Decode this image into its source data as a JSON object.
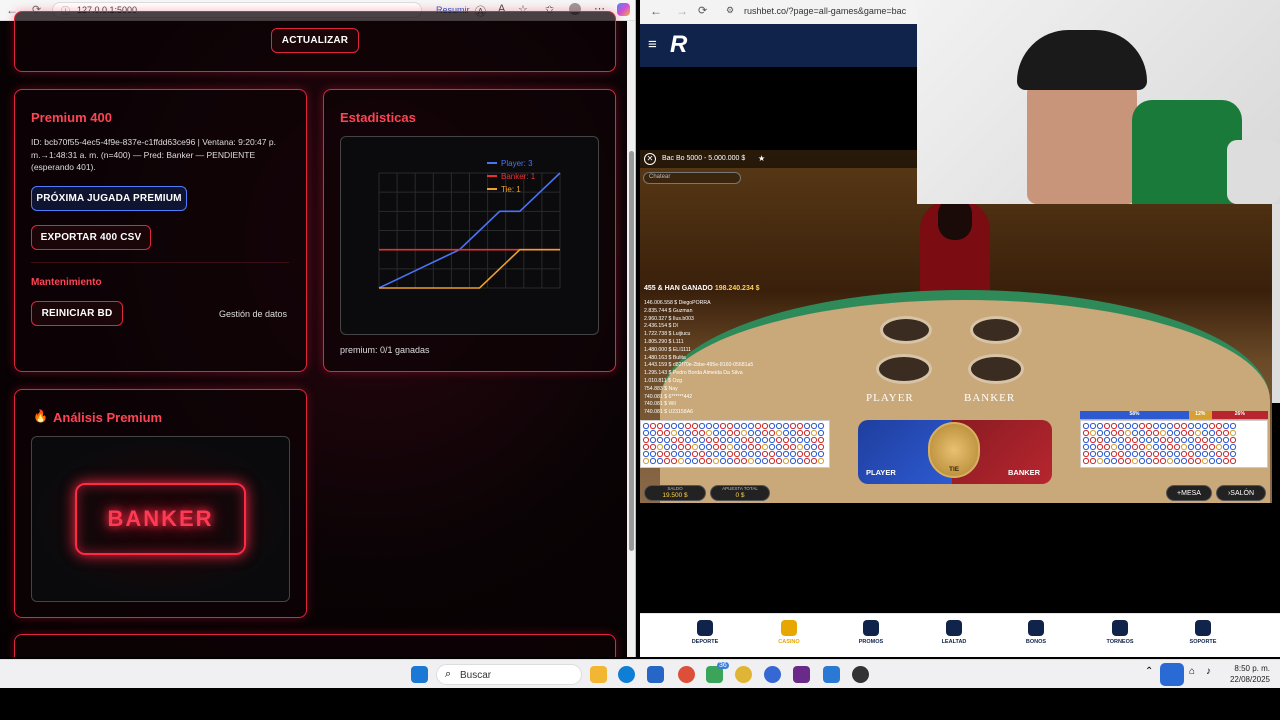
{
  "left_browser": {
    "url": "127.0.0.1:5000",
    "resumir": "Resumir",
    "actualizar_button": "ACTUALIZAR",
    "premium": {
      "title": "Premium 400",
      "info": "ID: bcb70f55-4ec5-4f9e-837e-c1ffdd63ce96 | Ventana: 9:20:47 p. m.→1:48:31 a. m. (n=400) — Pred: Banker — PENDIENTE (esperando 401).",
      "next_button": "PRÓXIMA JUGADA PREMIUM",
      "export_button": "EXPORTAR 400 CSV",
      "maintenance_title": "Mantenimiento",
      "reset_button": "REINICIAR BD",
      "data_mgmt": "Gestión de datos"
    },
    "stats": {
      "title": "Estadisticas",
      "footer": "premium: 0/1 ganadas"
    },
    "analysis": {
      "title": "Análisis Premium",
      "prediction": "BANKER"
    }
  },
  "chart_data": {
    "type": "line",
    "x": [
      1,
      2,
      3,
      4,
      5,
      6,
      7,
      8,
      9,
      10
    ],
    "series": [
      {
        "name": "Player: 3",
        "color": "#4a73f5",
        "values": [
          0,
          0.25,
          0.5,
          0.75,
          1,
          1.5,
          2,
          2,
          2.5,
          3
        ]
      },
      {
        "name": "Banker: 1",
        "color": "#e83232",
        "values": [
          1,
          1,
          1,
          1,
          1,
          1,
          1,
          1,
          1,
          1
        ]
      },
      {
        "name": "Tie: 1",
        "color": "#f0a02a",
        "values": [
          0,
          0,
          0,
          0,
          0,
          0,
          0.5,
          1,
          1,
          1
        ]
      }
    ],
    "ylim": [
      0,
      3
    ],
    "grid": true,
    "legend": "top-right"
  },
  "right_browser": {
    "url": "rushbet.co/?page=all-games&game=bac",
    "game_title": "Bac Bo 5000 - 5.000.000 $",
    "search": "Chatear",
    "winners_header": "455 & HAN GANADO",
    "winners_amount": "198.240.234 $",
    "winners": [
      "146.006.558 $ DiegoPORRA",
      "2.835.744 $ Guzman",
      "2.960.327 $ Ilus.b003",
      "2.436.154 $ Dl",
      "1.722.738 $ Luijiucu",
      "1.805.290 $ L111",
      "1.480.000 $ ELI1111",
      "1.480.163 $ Bulita",
      "1.443.159 $ d82f70e-2bbe-495e-8160-05681a5",
      "1.295.143 $ Pedro Borda Almeida Da Silva",
      "1.010.811 $ Ozg",
      "754.883 $ Nay",
      "740.081 $ 6******442",
      "740.081 $ Wil",
      "740.081 $ U23158A6"
    ],
    "table_player": "PLAYER",
    "table_banker": "BANKER",
    "bet_player": "PLAYER",
    "bet_tie": "TIE",
    "bet_banker": "BANKER",
    "stats_pct": [
      "58%",
      "12%",
      "26%"
    ],
    "saldo_label": "SALDO",
    "saldo_value": "19.500 $",
    "apuesta_label": "APUESTA TOTAL",
    "apuesta_value": "0 $",
    "mesa_button": "MESA",
    "salon_button": "SALÓN",
    "nav": [
      "DEPORTE",
      "CASINO",
      "PROMOS",
      "LEALTAD",
      "BONOS",
      "TORNEOS",
      "SOPORTE"
    ]
  },
  "taskbar": {
    "search": "Buscar",
    "time": "8:50 p. m.",
    "date": "22/08/2025",
    "badge": "36"
  }
}
